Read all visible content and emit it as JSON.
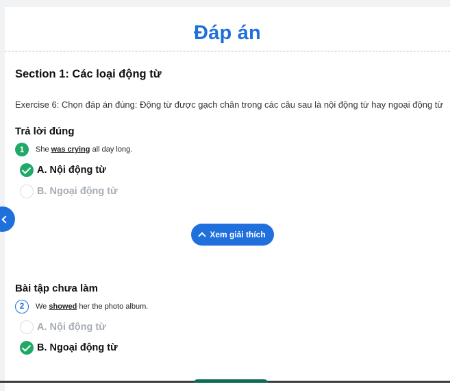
{
  "header": {
    "title": "Đáp án"
  },
  "section": {
    "title": "Section 1: Các loại động từ"
  },
  "exercise": {
    "instruction": "Exercise 6: Chọn đáp án đúng: Động từ được gạch chân trong các câu sau là nội động từ hay ngoại động từ"
  },
  "questions": [
    {
      "status_label": "Trả lời đúng",
      "number": "1",
      "text_before": "She",
      "text_highlight": "was crying",
      "text_after": "all day long.",
      "options": [
        {
          "label": "A. Nội động từ",
          "state": "correct"
        },
        {
          "label": "B. Ngoại động từ",
          "state": "muted"
        }
      ]
    },
    {
      "status_label": "Bài tập chưa làm",
      "number": "2",
      "text_before": "We",
      "text_highlight": "showed",
      "text_after": "her the photo album.",
      "options": [
        {
          "label": "A. Nội động từ",
          "state": "muted"
        },
        {
          "label": "B. Ngoại động từ",
          "state": "correct"
        }
      ]
    }
  ],
  "explain_button": {
    "label": "Xem giải thích",
    "icon": "chevron-up-icon"
  },
  "side_toggle": {
    "icon": "chevron-left-icon"
  },
  "colors": {
    "accent": "#1f6fdc",
    "success": "#1fa866",
    "muted": "#a7adb5"
  }
}
